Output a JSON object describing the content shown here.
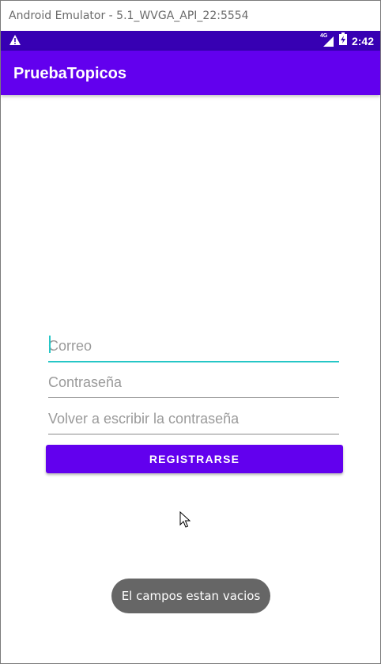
{
  "window": {
    "title": "Android Emulator - 5.1_WVGA_API_22:5554"
  },
  "statusbar": {
    "network": "4G",
    "time": "2:42",
    "warning_icon": "warning-icon",
    "signal_icon": "signal-icon",
    "battery_icon": "battery-charging-icon"
  },
  "appbar": {
    "title": "PruebaTopicos"
  },
  "form": {
    "email_placeholder": "Correo",
    "password_placeholder": "Contraseña",
    "confirm_placeholder": "Volver a escribir la contraseña",
    "register_label": "REGISTRARSE"
  },
  "toast": {
    "message": "El campos estan vacios"
  },
  "colors": {
    "primary": "#6200ee",
    "primary_dark": "#3700b3",
    "accent": "#26c6c6",
    "toast_bg": "#666666"
  }
}
